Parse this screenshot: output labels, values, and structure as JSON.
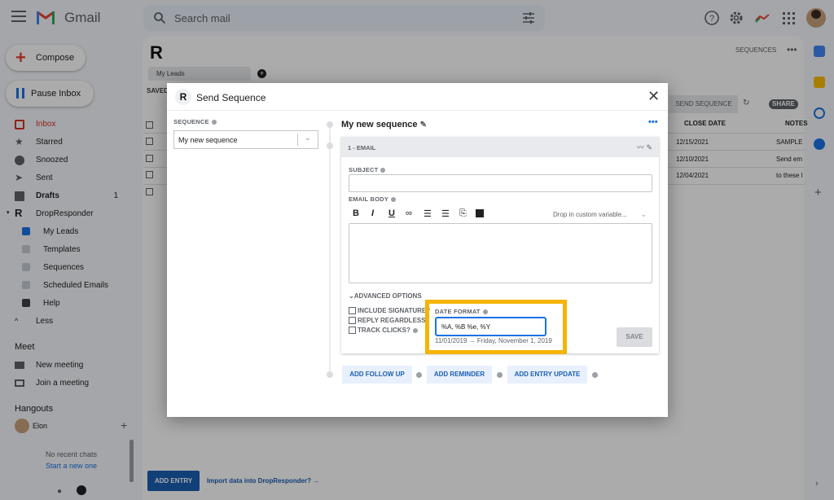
{
  "gmail": {
    "brand": "Gmail",
    "search_placeholder": "Search mail",
    "compose_label": "Compose",
    "pause_label": "Pause Inbox",
    "nav": [
      {
        "label": "Inbox",
        "icon": "inbox-icon"
      },
      {
        "label": "Starred",
        "icon": "star-icon"
      },
      {
        "label": "Snoozed",
        "icon": "clock-icon"
      },
      {
        "label": "Sent",
        "icon": "send-icon"
      },
      {
        "label": "Drafts",
        "icon": "draft-icon",
        "count": "1"
      },
      {
        "label": "DropResponder",
        "icon": "dropresponder-icon"
      }
    ],
    "sub_nav": [
      "My Leads",
      "Templates",
      "Sequences",
      "Scheduled Emails",
      "Help"
    ],
    "less_label": "Less",
    "meet_title": "Meet",
    "meet_items": [
      "New meeting",
      "Join a meeting"
    ],
    "hangouts_title": "Hangouts",
    "hangouts_user": "Elon",
    "no_chats": "No recent chats",
    "start_new": "Start a new one"
  },
  "dropresponder": {
    "logo": "R",
    "sequences_link": "SEQUENCES",
    "tab_label": "My Leads",
    "saved_label": "SAVED",
    "send_sequence_btn": "SEND SEQUENCE",
    "share_label": "SHARE",
    "columns": [
      "CLOSE DATE",
      "NOTES"
    ],
    "rows": [
      {
        "date": "12/15/2021",
        "note": "SAMPLE"
      },
      {
        "date": "12/10/2021",
        "note": "Send em"
      },
      {
        "date": "12/04/2021",
        "note": "to these l"
      }
    ],
    "add_entry": "ADD ENTRY",
    "import_link": "Import data into DropResponder? →"
  },
  "modal": {
    "title": "Send Sequence",
    "sequence_label": "SEQUENCE",
    "sequence_value": "My new sequence",
    "sequence_name": "My new sequence",
    "email_header": "1 - EMAIL",
    "subject_label": "SUBJECT",
    "email_body_label": "EMAIL BODY",
    "format_buttons": [
      "B",
      "I",
      "U"
    ],
    "drop_variable": "Drop in custom variable...",
    "advanced_options": "ADVANCED OPTIONS",
    "options": [
      "INCLUDE SIGNATURE?",
      "REPLY REGARDLESS?",
      "TRACK CLICKS?"
    ],
    "date_format_label": "DATE FORMAT",
    "date_format_value": "%A, %B %e, %Y",
    "date_preview": "11/01/2019 → Friday, November 1, 2019",
    "save_label": "SAVE",
    "actions": [
      "ADD FOLLOW UP",
      "ADD REMINDER",
      "ADD ENTRY UPDATE"
    ]
  },
  "colors": {
    "accent": "#1a73e8",
    "highlight": "#f5b400",
    "brand_button": "#1a5fb4"
  }
}
